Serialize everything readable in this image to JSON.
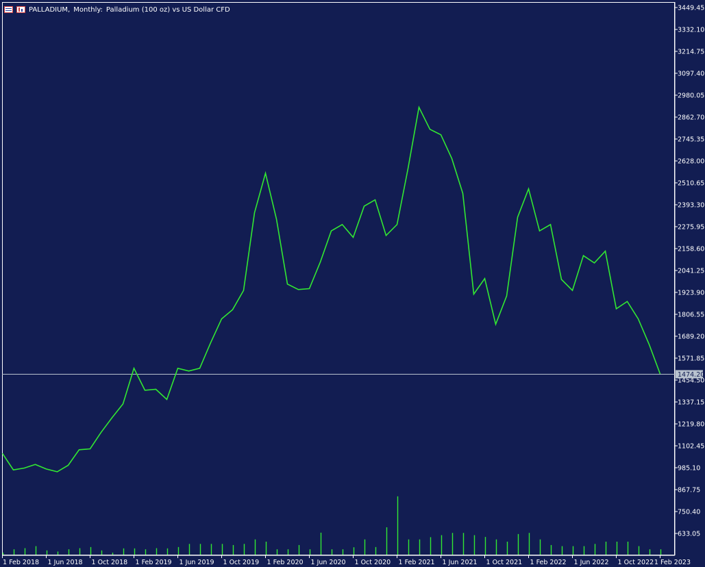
{
  "header": {
    "symbol": "PALLADIUM,",
    "period": "Monthly:",
    "description": "Palladium (100 oz) vs US Dollar CFD",
    "icons": [
      "list-icon",
      "bar-chart-icon"
    ]
  },
  "colors": {
    "background": "#121d52",
    "price_line": "#32e832",
    "volume": "#32e832",
    "current_price_line": "#b9c3cf",
    "axis": "#ffffff",
    "price_badge_bg": "#b9c3cf",
    "price_badge_text": "#121d52"
  },
  "chart_data": {
    "type": "line",
    "title": "PALLADIUM, Monthly: Palladium (100 oz) vs US Dollar CFD",
    "ylim": [
      603,
      3475
    ],
    "volume_scale_max": 820,
    "y_ticks": [
      "3449.45",
      "3332.10",
      "3214.75",
      "3097.40",
      "2980.05",
      "2862.70",
      "2745.35",
      "2628.00",
      "2510.65",
      "2393.30",
      "2275.95",
      "2158.60",
      "2041.25",
      "1923.90",
      "1806.55",
      "1689.20",
      "1571.85",
      "1454.50",
      "1337.15",
      "1219.80",
      "1102.45",
      "985.10",
      "867.75",
      "750.40",
      "633.05"
    ],
    "x_tick_labels": [
      "1 Feb 2018",
      "1 Jun 2018",
      "1 Oct 2018",
      "1 Feb 2019",
      "1 Jun 2019",
      "1 Oct 2019",
      "1 Feb 2020",
      "1 Jun 2020",
      "1 Oct 2020",
      "1 Feb 2021",
      "1 Jun 2021",
      "1 Oct 2021",
      "1 Feb 2022",
      "1 Jun 2022",
      "1 Oct 2022",
      "1 Feb 2023"
    ],
    "x_tick_months": [
      1,
      5,
      9,
      13,
      17,
      21,
      25,
      29,
      33,
      37,
      41,
      45,
      49,
      53,
      57,
      61
    ],
    "current_price": "1474.20",
    "current_price_value": 1474.2,
    "series": [
      {
        "values": [
          1040,
          950,
          960,
          980,
          955,
          940,
          975,
          1060,
          1065,
          1155,
          1235,
          1310,
          1505,
          1385,
          1390,
          1335,
          1505,
          1490,
          1505,
          1645,
          1775,
          1825,
          1930,
          2355,
          2570,
          2320,
          1965,
          1935,
          1940,
          2085,
          2255,
          2290,
          2220,
          2390,
          2425,
          2230,
          2290,
          2595,
          2930,
          2810,
          2780,
          2650,
          2460,
          1910,
          1995,
          1745,
          1900,
          2330,
          2485,
          2255,
          2290,
          1990,
          1930,
          2120,
          2080,
          2145,
          1830,
          1870,
          1775,
          1635,
          1474.2
        ]
      },
      {
        "name": "Volume",
        "values": [
          9,
          24,
          29,
          38,
          19,
          14,
          24,
          29,
          34,
          19,
          9,
          28,
          28,
          24,
          29,
          28,
          34,
          48,
          48,
          48,
          48,
          43,
          48,
          68,
          58,
          24,
          24,
          43,
          24,
          98,
          24,
          24,
          33,
          68,
          34,
          122,
          260,
          68,
          68,
          78,
          87,
          97,
          97,
          87,
          79,
          68,
          58,
          92,
          97,
          68,
          43,
          38,
          38,
          38,
          48,
          58,
          58,
          58,
          38,
          24,
          24
        ]
      }
    ]
  }
}
